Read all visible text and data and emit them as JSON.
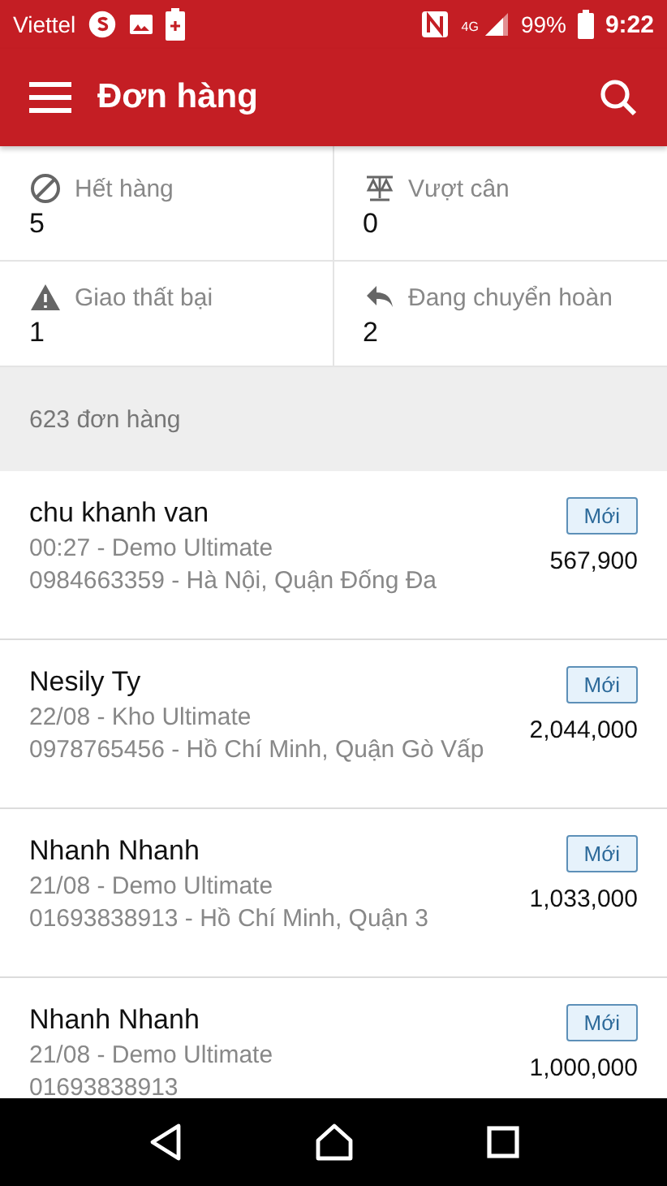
{
  "status_bar": {
    "carrier": "Viettel",
    "network": "4G",
    "battery": "99%",
    "time": "9:22"
  },
  "app_bar": {
    "title": "Đơn hàng"
  },
  "stats": [
    {
      "kind": "blocked",
      "label": "Hết hàng",
      "value": "5"
    },
    {
      "kind": "scale",
      "label": "Vượt cân",
      "value": "0"
    },
    {
      "kind": "warning",
      "label": "Giao thất bại",
      "value": "1"
    },
    {
      "kind": "return",
      "label": "Đang chuyển hoàn",
      "value": "2"
    }
  ],
  "order_count": "623 đơn hàng",
  "orders": [
    {
      "name": "chu khanh van",
      "meta": "00:27 - Demo Ultimate",
      "address": "0984663359 - Hà Nội, Quận Đống Đa",
      "status": "Mới",
      "amount": "567,900"
    },
    {
      "name": "Nesily Ty",
      "meta": "22/08 - Kho Ultimate",
      "address": "0978765456 - Hồ Chí Minh, Quận Gò Vấp",
      "status": "Mới",
      "amount": "2,044,000"
    },
    {
      "name": "Nhanh Nhanh",
      "meta": "21/08 - Demo Ultimate",
      "address": "01693838913 - Hồ Chí Minh, Quận 3",
      "status": "Mới",
      "amount": "1,033,000"
    },
    {
      "name": "Nhanh Nhanh",
      "meta": "21/08 - Demo Ultimate",
      "address": "01693838913",
      "status": "Mới",
      "amount": "1,000,000"
    }
  ]
}
